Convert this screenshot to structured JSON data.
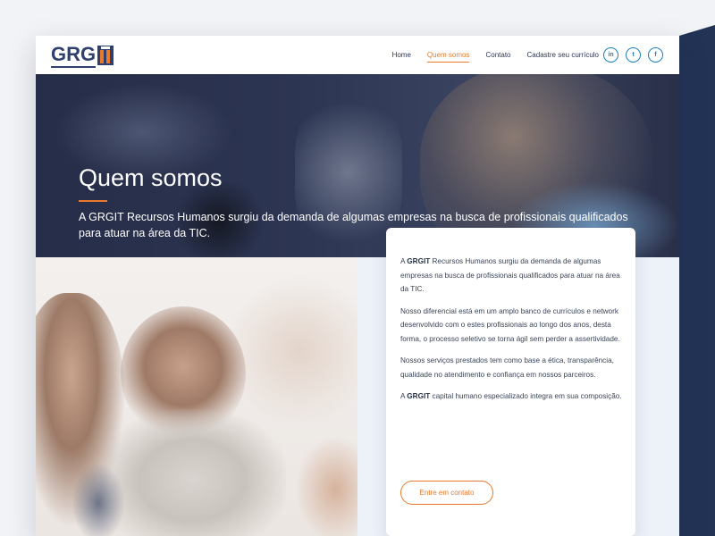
{
  "brand": {
    "logo_text": "GRG",
    "accent": "#e9792c",
    "navy": "#2f3f6e"
  },
  "nav": {
    "items": [
      {
        "label": "Home",
        "active": false
      },
      {
        "label": "Quem somos",
        "active": true
      },
      {
        "label": "Contato",
        "active": false
      },
      {
        "label": "Cadastre seu currículo",
        "active": false
      }
    ]
  },
  "social": {
    "linkedin": "in",
    "twitter": "t",
    "facebook": "f"
  },
  "hero": {
    "title": "Quem somos",
    "subtitle": "A GRGIT Recursos Humanos surgiu da demanda de algumas empresas na busca de profissionais qualificados para atuar na área da TIC."
  },
  "card": {
    "p1_prefix": "A ",
    "p1_strong": "GRGIT",
    "p1_rest": " Recursos Humanos surgiu da demanda de algumas empresas na busca de profissionais qualificados para atuar na área da TIC.",
    "p2": "Nosso diferencial está em um amplo banco de currículos e network desenvolvido com o estes profissionais ao longo dos anos, desta forma, o processo seletivo se torna ágil sem perder a assertividade.",
    "p3": "Nossos serviços prestados tem como base a ética, transparência, qualidade no atendimento e confiança em nossos parceiros.",
    "p4_prefix": "A ",
    "p4_strong": "GRGIT",
    "p4_rest": " capital humano especializado integra em sua composição.",
    "cta_label": "Entre em contato"
  }
}
